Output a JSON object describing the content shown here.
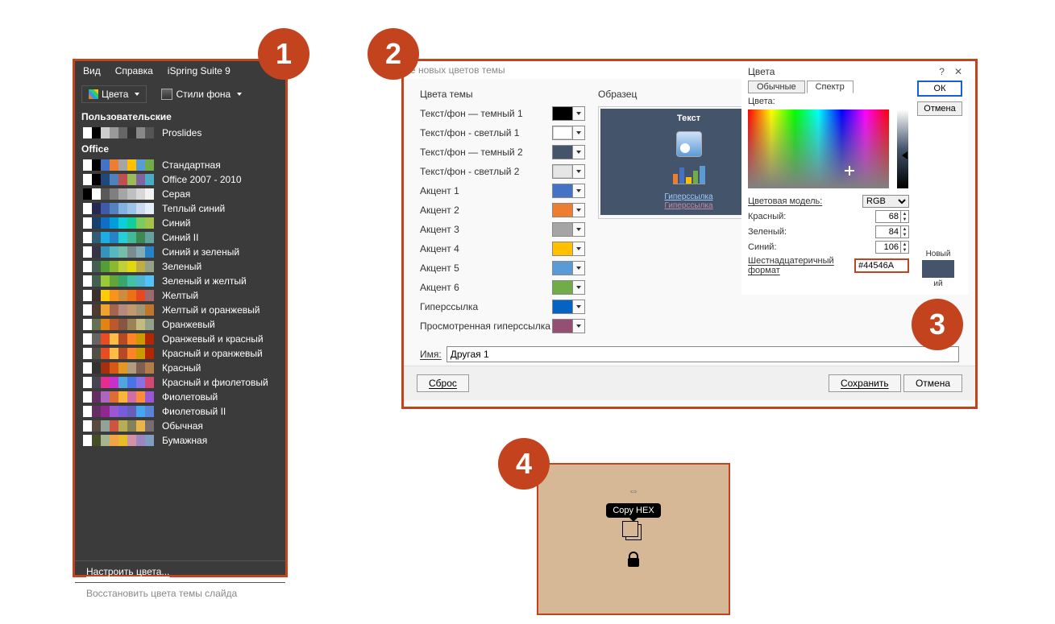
{
  "badges": {
    "b1": "1",
    "b2": "2",
    "b3": "3",
    "b4": "4"
  },
  "panel1": {
    "menu": {
      "view": "Вид",
      "help": "Справка",
      "ispring": "iSpring Suite 9"
    },
    "ribbon": {
      "colors": "Цвета",
      "bgstyles": "Стили фона"
    },
    "section_user": "Пользовательские",
    "user_items": [
      {
        "label": "Proslides",
        "swatches": [
          "#fff",
          "#000",
          "#ccc",
          "#999",
          "#666",
          "#333",
          "#888",
          "#555"
        ]
      }
    ],
    "section_office": "Office",
    "office_items": [
      {
        "label": "Стандартная",
        "swatches": [
          "#fff",
          "#000",
          "#4472C4",
          "#ED7D31",
          "#A5A5A5",
          "#FFC000",
          "#5B9BD5",
          "#70AD47"
        ]
      },
      {
        "label": "Office 2007 - 2010",
        "swatches": [
          "#fff",
          "#000",
          "#1F497D",
          "#4F81BD",
          "#C0504D",
          "#9BBB59",
          "#8064A2",
          "#4BACC6"
        ]
      },
      {
        "label": "Серая",
        "swatches": [
          "#000",
          "#fff",
          "#595959",
          "#7F7F7F",
          "#A5A5A5",
          "#BFBFBF",
          "#D8D8D8",
          "#F2F2F2"
        ]
      },
      {
        "label": "Теплый синий",
        "swatches": [
          "#fff",
          "#242852",
          "#3E5AA8",
          "#5581C0",
          "#83B2E0",
          "#9DC3E6",
          "#C9DAF0",
          "#E3EEF9"
        ]
      },
      {
        "label": "Синий",
        "swatches": [
          "#fff",
          "#17406D",
          "#0F6FC6",
          "#009DD9",
          "#0BD0D9",
          "#10CF9B",
          "#7CCA62",
          "#A5C249"
        ]
      },
      {
        "label": "Синий II",
        "swatches": [
          "#fff",
          "#335B74",
          "#1CADE4",
          "#2683C6",
          "#27CED7",
          "#42BA97",
          "#3E8853",
          "#62A39F"
        ]
      },
      {
        "label": "Синий и зеленый",
        "swatches": [
          "#fff",
          "#373545",
          "#3494BA",
          "#58B6C0",
          "#75BDA7",
          "#7A8C8E",
          "#84ACB6",
          "#2683C6"
        ]
      },
      {
        "label": "Зеленый",
        "swatches": [
          "#fff",
          "#455F51",
          "#549E39",
          "#8AB833",
          "#C0CF3A",
          "#E2D810",
          "#BFAE48",
          "#94A088"
        ]
      },
      {
        "label": "Зеленый и желтый",
        "swatches": [
          "#fff",
          "#455F51",
          "#99CB38",
          "#63A537",
          "#37A76F",
          "#44C1A3",
          "#4EB3CF",
          "#51C3F9"
        ]
      },
      {
        "label": "Желтый",
        "swatches": [
          "#fff",
          "#39302A",
          "#FFCA08",
          "#F8931D",
          "#CE8D3E",
          "#EC7016",
          "#E64823",
          "#9C6A6A"
        ]
      },
      {
        "label": "Желтый и оранжевый",
        "swatches": [
          "#fff",
          "#4E3B30",
          "#F0A22E",
          "#A5644E",
          "#B58B80",
          "#C3986D",
          "#A19574",
          "#C17529"
        ]
      },
      {
        "label": "Оранжевый",
        "swatches": [
          "#fff",
          "#637052",
          "#E48312",
          "#BD582C",
          "#865640",
          "#9B8357",
          "#C2BC80",
          "#94A088"
        ]
      },
      {
        "label": "Оранжевый и красный",
        "swatches": [
          "#fff",
          "#696464",
          "#E84C22",
          "#FFBD47",
          "#B64926",
          "#FF8427",
          "#CC9900",
          "#B22600"
        ]
      },
      {
        "label": "Красный и оранжевый",
        "swatches": [
          "#fff",
          "#505046",
          "#E84C22",
          "#FFBD47",
          "#B64926",
          "#FF8427",
          "#CC9900",
          "#B22600"
        ]
      },
      {
        "label": "Красный",
        "swatches": [
          "#fff",
          "#323232",
          "#A5300F",
          "#D55816",
          "#E19825",
          "#B19C7D",
          "#7F5F52",
          "#B27D49"
        ]
      },
      {
        "label": "Красный и фиолетовый",
        "swatches": [
          "#fff",
          "#454551",
          "#E32D91",
          "#C830CC",
          "#4EA6DC",
          "#4775E7",
          "#8971E1",
          "#D54773"
        ]
      },
      {
        "label": "Фиолетовый",
        "swatches": [
          "#fff",
          "#632E62",
          "#AC66BB",
          "#DE6C36",
          "#F9B639",
          "#CF6DA4",
          "#FA8D3D",
          "#9B57D3"
        ]
      },
      {
        "label": "Фиолетовый II",
        "swatches": [
          "#fff",
          "#632E62",
          "#92278F",
          "#9B57D3",
          "#755DD9",
          "#665EB8",
          "#45A5ED",
          "#5982DB"
        ]
      },
      {
        "label": "Обычная",
        "swatches": [
          "#fff",
          "#564B3C",
          "#93A299",
          "#CF543F",
          "#B5AE53",
          "#848058",
          "#E8B54D",
          "#786C71"
        ]
      },
      {
        "label": "Бумажная",
        "swatches": [
          "#fff",
          "#444D26",
          "#A5B592",
          "#F3A447",
          "#E7BC29",
          "#D092A7",
          "#9C85C0",
          "#809EC2"
        ]
      }
    ],
    "customize": "Настроить цвета...",
    "restore": "Восстановить цвета темы слайда"
  },
  "panel2": {
    "titlebar": "е новых цветов темы",
    "group_theme": "Цвета темы",
    "group_sample": "Образец",
    "rows": [
      {
        "label": "Текст/фон — темный 1",
        "sw": "#000000"
      },
      {
        "label": "Текст/фон - светлый 1",
        "sw": "#FFFFFF"
      },
      {
        "label": "Текст/фон — темный 2",
        "sw": "#44546A"
      },
      {
        "label": "Текст/фон - светлый 2",
        "sw": "#E7E6E6"
      },
      {
        "label": "Акцент 1",
        "sw": "#4472C4"
      },
      {
        "label": "Акцент 2",
        "sw": "#ED7D31"
      },
      {
        "label": "Акцент 3",
        "sw": "#A5A5A5"
      },
      {
        "label": "Акцент 4",
        "sw": "#FFC000"
      },
      {
        "label": "Акцент 5",
        "sw": "#5B9BD5"
      },
      {
        "label": "Акцент 6",
        "sw": "#70AD47"
      },
      {
        "label": "Гиперссылка",
        "sw": "#0563C1"
      },
      {
        "label": "Просмотренная гиперссылка",
        "sw": "#954F72"
      }
    ],
    "sample": {
      "text": "Текст",
      "hlink": "Гиперссылка",
      "vhlink": "Гиперссылка"
    },
    "name_label": "Имя:",
    "name_value": "Другая 1",
    "reset": "Сброс",
    "save": "Сохранить",
    "cancel": "Отмена"
  },
  "panel3": {
    "title": "Цвета",
    "tab_standard": "Обычные",
    "tab_spectrum": "Спектр",
    "colors_label": "Цвета:",
    "ok": "ОК",
    "cancel": "Отмена",
    "model_label": "Цветовая модель:",
    "model_value": "RGB",
    "red_label": "Красный:",
    "red_value": "68",
    "green_label": "Зеленый:",
    "green_value": "84",
    "blue_label": "Синий:",
    "blue_value": "106",
    "hex_label": "Шестнадцатеричный формат",
    "hex_value": "#44546A",
    "new_label": "Новый",
    "current_label": "ий"
  },
  "panel4": {
    "tooltip": "Copy HEX"
  }
}
